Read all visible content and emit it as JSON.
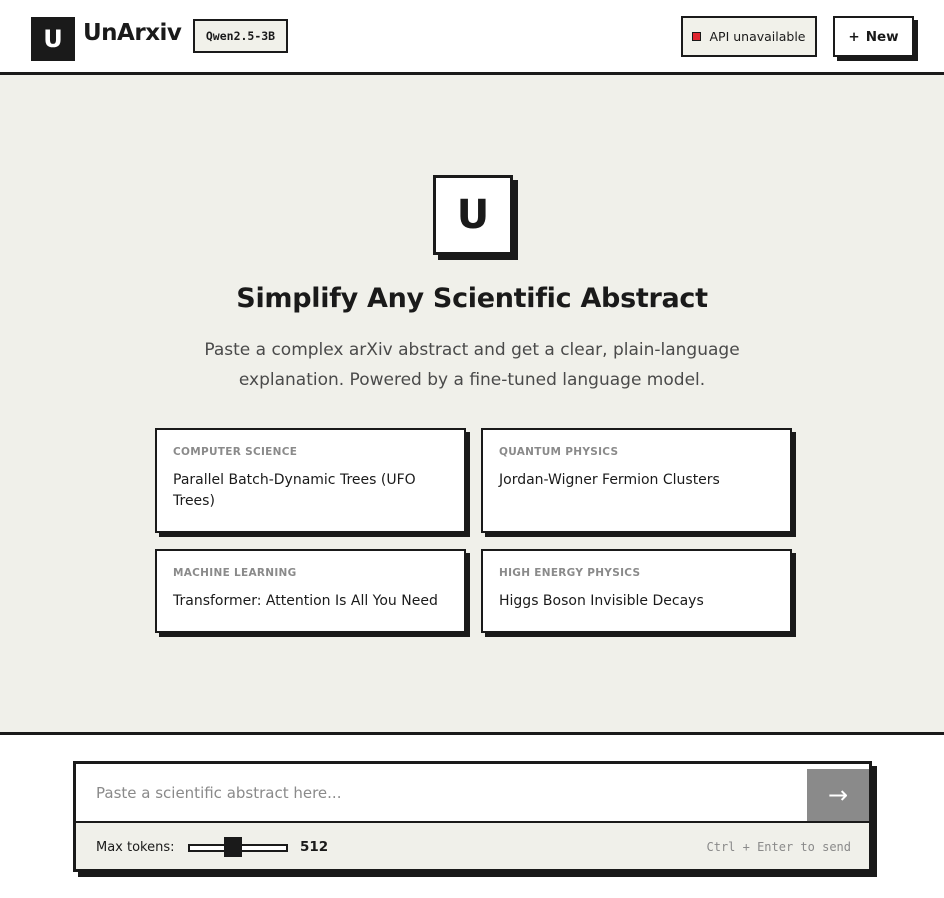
{
  "header": {
    "logo_letter": "U",
    "app_name": "UnArxiv",
    "model_badge": "Qwen2.5-3B",
    "api_status": "API unavailable",
    "new_button": "New",
    "new_button_icon": "+"
  },
  "hero": {
    "icon_letter": "U",
    "title": "Simplify Any Scientific Abstract",
    "subtitle": "Paste a complex arXiv abstract and get a clear, plain-language explanation. Powered by a fine-tuned language model."
  },
  "examples": [
    {
      "category": "COMPUTER SCIENCE",
      "title": "Parallel Batch-Dynamic Trees (UFO Trees)"
    },
    {
      "category": "QUANTUM PHYSICS",
      "title": "Jordan-Wigner Fermion Clusters"
    },
    {
      "category": "MACHINE LEARNING",
      "title": "Transformer: Attention Is All You Need"
    },
    {
      "category": "HIGH ENERGY PHYSICS",
      "title": "Higgs Boson Invisible Decays"
    }
  ],
  "composer": {
    "placeholder": "Paste a scientific abstract here...",
    "send_icon": "→",
    "max_tokens_label": "Max tokens:",
    "max_tokens_value": "512",
    "hint": "Ctrl + Enter to send"
  },
  "colors": {
    "ink": "#1a1a1a",
    "background": "#f0f0ea",
    "status_error": "#e0262f",
    "muted": "#8a8a8a"
  }
}
